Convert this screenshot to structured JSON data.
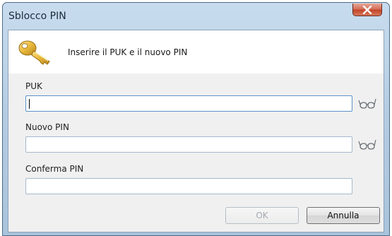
{
  "window": {
    "title": "Sblocco PIN"
  },
  "header": {
    "icon": "key-icon",
    "message": "Inserire il PUK e il nuovo PIN"
  },
  "fields": [
    {
      "label": "PUK",
      "value": "",
      "has_reveal": true,
      "focused": true
    },
    {
      "label": "Nuovo PIN",
      "value": "",
      "has_reveal": true,
      "focused": false
    },
    {
      "label": "Conferma PIN",
      "value": "",
      "has_reveal": false,
      "focused": false
    }
  ],
  "buttons": {
    "ok_label": "OK",
    "ok_enabled": false,
    "cancel_label": "Annulla"
  },
  "colors": {
    "titlebar": "#b5cde3",
    "close_button": "#c1442b",
    "form_background": "#f0f0f0",
    "key": "#e0b23a"
  }
}
